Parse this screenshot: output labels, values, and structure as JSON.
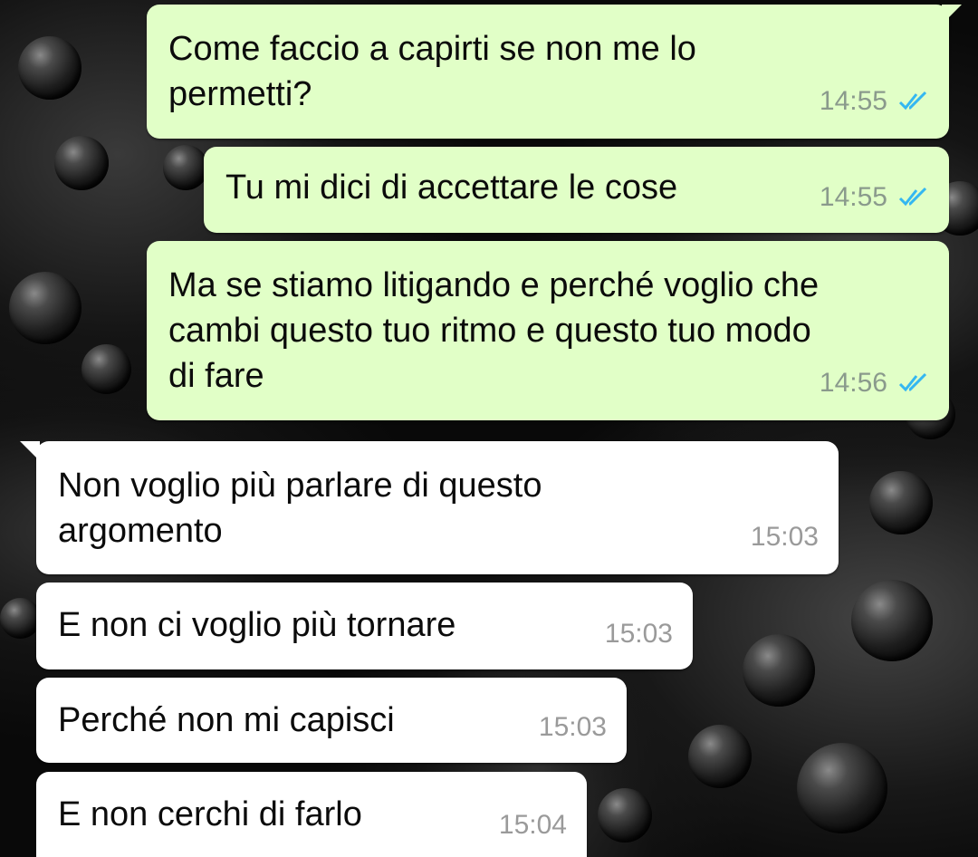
{
  "chat": {
    "messages": [
      {
        "direction": "out",
        "text": "Come faccio a capirti se non me lo\npermetti?",
        "time": "14:55",
        "status_icon": "double-check-read-icon"
      },
      {
        "direction": "out",
        "text": "Tu mi dici di accettare le cose",
        "time": "14:55",
        "status_icon": "double-check-read-icon"
      },
      {
        "direction": "out",
        "text": "Ma se stiamo litigando e perché voglio che\ncambi questo tuo ritmo e questo tuo modo\ndi fare",
        "time": "14:56",
        "status_icon": "double-check-read-icon"
      },
      {
        "direction": "in",
        "text": "Non voglio più parlare di questo\nargomento",
        "time": "15:03"
      },
      {
        "direction": "in",
        "text": "E non ci voglio più tornare",
        "time": "15:03"
      },
      {
        "direction": "in",
        "text": "Perché non mi capisci",
        "time": "15:03"
      },
      {
        "direction": "in",
        "text": "E non cerchi di farlo",
        "time": "15:04"
      }
    ]
  },
  "colors": {
    "outgoing_bubble": "#e1ffc7",
    "incoming_bubble": "#ffffff",
    "read_check": "#34b7f1",
    "timestamp": "#8a9a8c"
  }
}
